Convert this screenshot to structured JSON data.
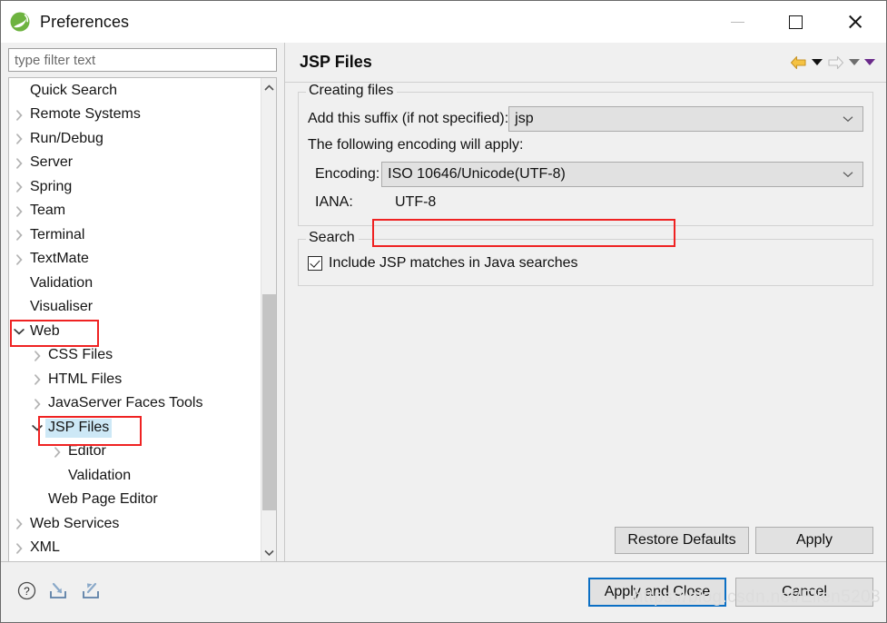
{
  "window": {
    "title": "Preferences",
    "logo_icon": "spring-leaf-logo",
    "controls": {
      "minimize": "minimize-icon",
      "maximize": "maximize-icon",
      "close": "close-icon"
    }
  },
  "sidebar": {
    "filter": {
      "value": "",
      "placeholder": "type filter text"
    },
    "items": [
      {
        "label": "Quick Search",
        "indent": 0,
        "twisty": "none",
        "selected": false
      },
      {
        "label": "Remote Systems",
        "indent": 0,
        "twisty": "collapsed",
        "selected": false
      },
      {
        "label": "Run/Debug",
        "indent": 0,
        "twisty": "collapsed",
        "selected": false
      },
      {
        "label": "Server",
        "indent": 0,
        "twisty": "collapsed",
        "selected": false
      },
      {
        "label": "Spring",
        "indent": 0,
        "twisty": "collapsed",
        "selected": false
      },
      {
        "label": "Team",
        "indent": 0,
        "twisty": "collapsed",
        "selected": false
      },
      {
        "label": "Terminal",
        "indent": 0,
        "twisty": "collapsed",
        "selected": false
      },
      {
        "label": "TextMate",
        "indent": 0,
        "twisty": "collapsed",
        "selected": false
      },
      {
        "label": "Validation",
        "indent": 0,
        "twisty": "none",
        "selected": false
      },
      {
        "label": "Visualiser",
        "indent": 0,
        "twisty": "none",
        "selected": false
      },
      {
        "label": "Web",
        "indent": 0,
        "twisty": "expanded",
        "selected": false
      },
      {
        "label": "CSS Files",
        "indent": 1,
        "twisty": "collapsed",
        "selected": false
      },
      {
        "label": "HTML Files",
        "indent": 1,
        "twisty": "collapsed",
        "selected": false
      },
      {
        "label": "JavaServer Faces Tools",
        "indent": 1,
        "twisty": "collapsed",
        "selected": false
      },
      {
        "label": "JSP Files",
        "indent": 1,
        "twisty": "expanded",
        "selected": true
      },
      {
        "label": "Editor",
        "indent": 2,
        "twisty": "collapsed",
        "selected": false
      },
      {
        "label": "Validation",
        "indent": 2,
        "twisty": "none",
        "selected": false
      },
      {
        "label": "Web Page Editor",
        "indent": 1,
        "twisty": "none",
        "selected": false
      },
      {
        "label": "Web Services",
        "indent": 0,
        "twisty": "collapsed",
        "selected": false
      },
      {
        "label": "XML",
        "indent": 0,
        "twisty": "collapsed",
        "selected": false
      }
    ],
    "scrollbar": {
      "up_icon": "chevron-up-icon",
      "down_icon": "chevron-down-icon"
    }
  },
  "page": {
    "title": "JSP Files",
    "nav": {
      "back_icon": "back-arrow-icon",
      "back_menu_icon": "caret-down-icon",
      "forward_icon": "forward-arrow-icon",
      "forward_menu_icon": "caret-down-icon",
      "more_menu_icon": "caret-down-icon"
    },
    "creating_files": {
      "legend": "Creating files",
      "suffix_label": "Add this suffix (if not specified):",
      "suffix_value": "jsp",
      "encoding_intro": "The following encoding will apply:",
      "encoding_label": "Encoding:",
      "encoding_value": "ISO 10646/Unicode(UTF-8)",
      "iana_label": "IANA:",
      "iana_value": "UTF-8",
      "dropdown_icon": "chevron-down-icon"
    },
    "search": {
      "legend": "Search",
      "checkbox_label": "Include JSP matches in Java searches",
      "checkbox_checked": true
    },
    "actions": {
      "restore_defaults": "Restore Defaults",
      "apply": "Apply"
    }
  },
  "footer": {
    "icons": [
      {
        "name": "help-icon"
      },
      {
        "name": "import-icon"
      },
      {
        "name": "export-icon"
      }
    ],
    "apply_and_close": "Apply and Close",
    "cancel": "Cancel"
  },
  "watermark": "https://blog.csdn.net/Ellen5203",
  "colors": {
    "accent_focus": "#0b6fc4",
    "annotation_red": "#ef2222",
    "selection_blue": "#cde8f6",
    "logo_green": "#6db33f"
  }
}
